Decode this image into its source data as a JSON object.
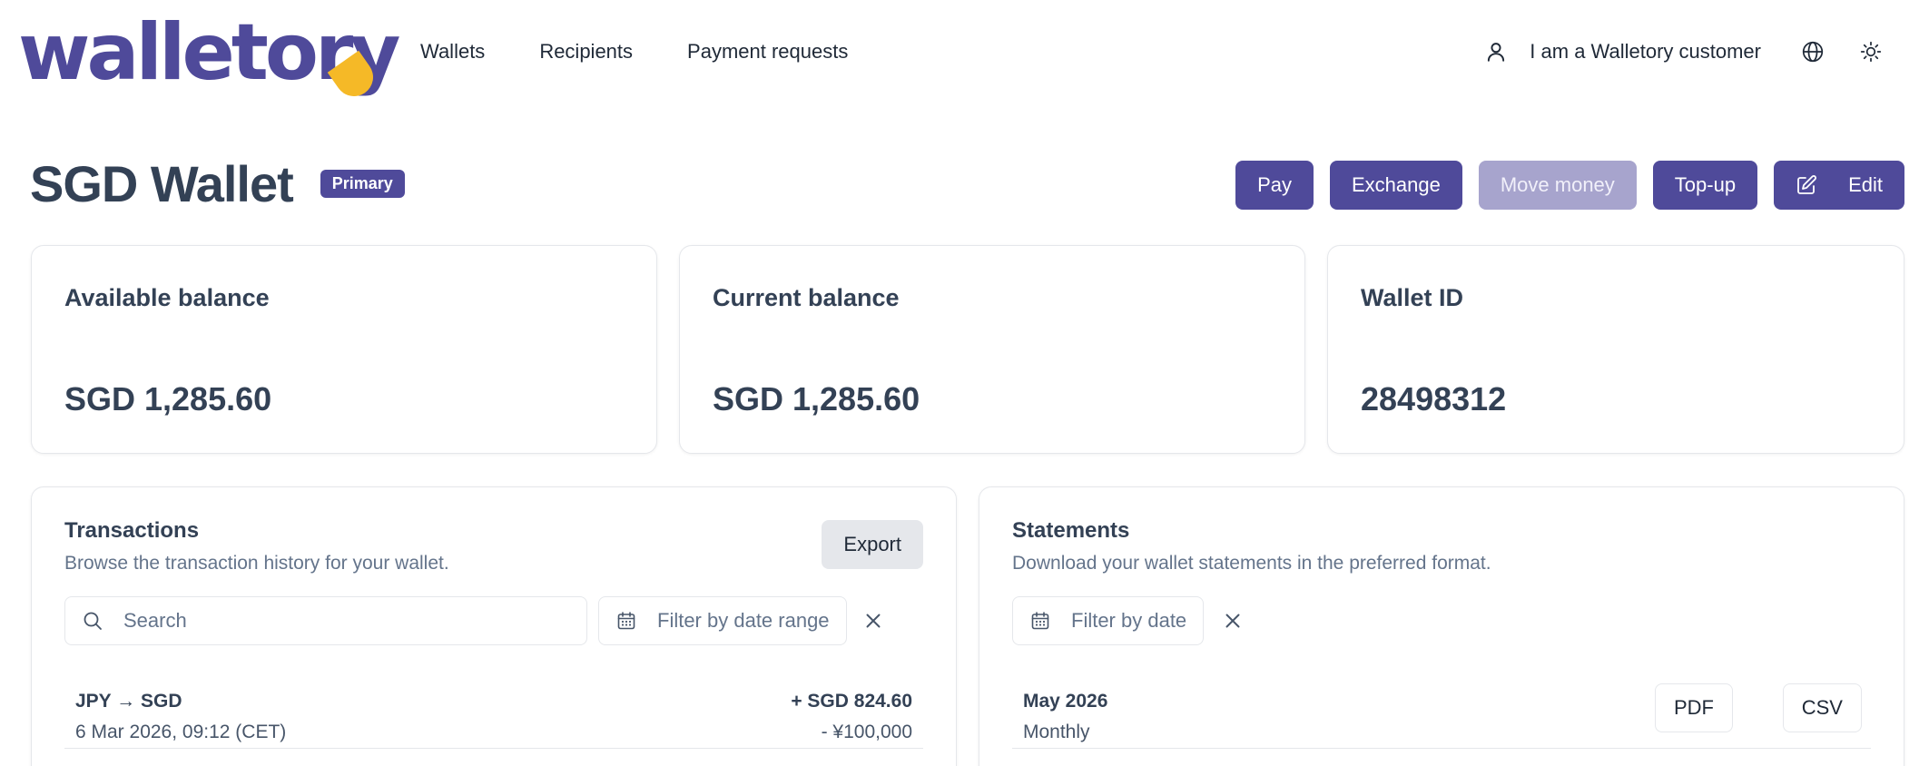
{
  "header": {
    "logo_text": "walletory",
    "nav": [
      "Wallets",
      "Recipients",
      "Payment requests"
    ],
    "customer_link": "I am a Walletory customer"
  },
  "wallet": {
    "title": "SGD Wallet",
    "badge": "Primary",
    "actions": {
      "pay": "Pay",
      "exchange": "Exchange",
      "move_money": "Move money",
      "top_up": "Top-up",
      "edit": "Edit"
    }
  },
  "balances": [
    {
      "label": "Available balance",
      "value": "SGD 1,285.60"
    },
    {
      "label": "Current balance",
      "value": "SGD 1,285.60"
    },
    {
      "label": "Wallet ID",
      "value": "28498312"
    }
  ],
  "transactions": {
    "title": "Transactions",
    "subtitle": "Browse the transaction history for your wallet.",
    "export_label": "Export",
    "search_placeholder": "Search",
    "date_filter_placeholder": "Filter by date range",
    "items": [
      {
        "title": "JPY → SGD",
        "date": "6 Mar 2026, 09:12 (CET)",
        "amount": "+ SGD 824.60",
        "original": "- ¥100,000"
      }
    ]
  },
  "statements": {
    "title": "Statements",
    "subtitle": "Download your wallet statements in the preferred format.",
    "date_filter_placeholder": "Filter by date",
    "items": [
      {
        "period": "May 2026",
        "frequency": "Monthly",
        "pdf_label": "PDF",
        "csv_label": "CSV"
      }
    ]
  },
  "colors": {
    "brand": "#4f4a9a",
    "brand_disabled": "#a7a4cd",
    "logo_accent": "#f5b927",
    "text": "#334155",
    "muted": "#64748b",
    "border": "#e5e7eb"
  },
  "icons": [
    "user-icon",
    "globe-icon",
    "sun-icon",
    "edit-icon",
    "search-icon",
    "calendar-icon",
    "close-icon"
  ]
}
